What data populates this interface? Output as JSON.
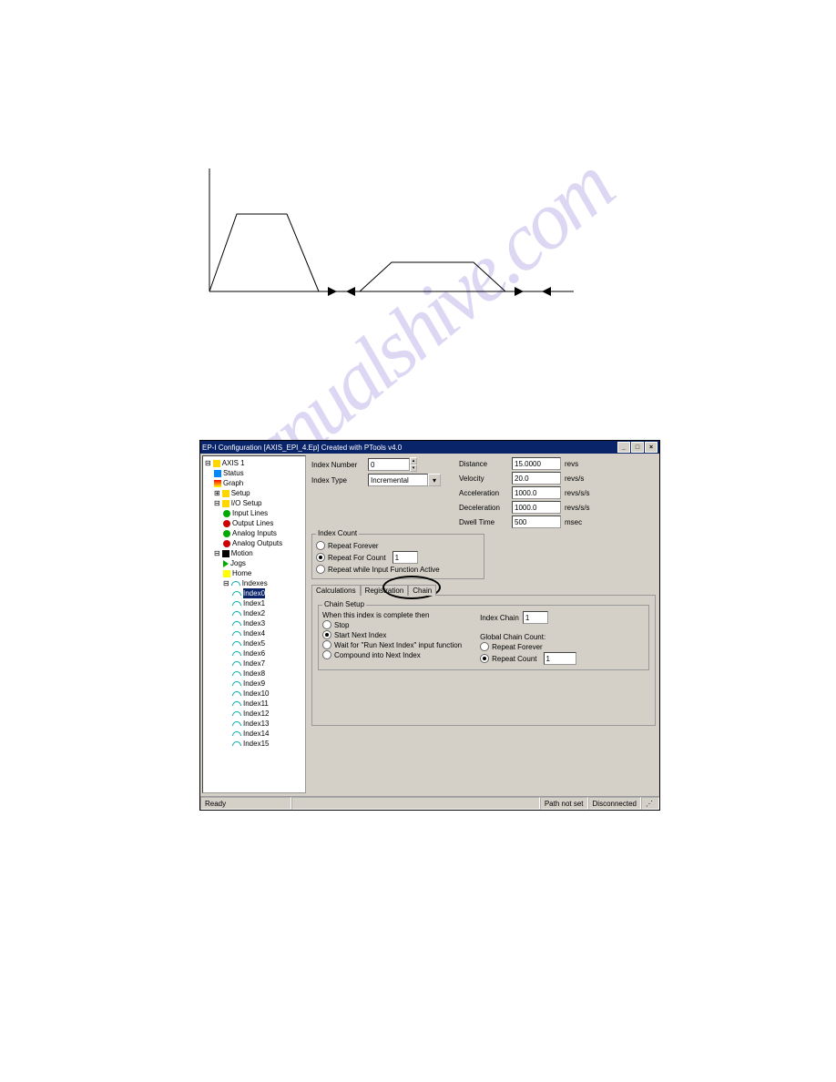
{
  "watermark": "manualshive.com",
  "chart_data": {
    "type": "line",
    "description": "Two trapezoidal velocity profiles with dwell arrows between them"
  },
  "window": {
    "title": "EP-I Configuration  [AXIS_EPI_4.Ep] Created with PTools v4.0",
    "min": "_",
    "max": "□",
    "close": "×"
  },
  "tree": {
    "root": "AXIS 1",
    "status": "Status",
    "graph": "Graph",
    "setup": "Setup",
    "iosetup": "I/O Setup",
    "inputlines": "Input Lines",
    "outputlines": "Output Lines",
    "analoginputs": "Analog Inputs",
    "analogoutputs": "Analog Outputs",
    "motion": "Motion",
    "jogs": "Jogs",
    "home": "Home",
    "indexes": "Indexes",
    "idx": [
      "Index0",
      "Index1",
      "Index2",
      "Index3",
      "Index4",
      "Index5",
      "Index6",
      "Index7",
      "Index8",
      "Index9",
      "Index10",
      "Index11",
      "Index12",
      "Index13",
      "Index14",
      "Index15"
    ]
  },
  "form": {
    "indexnum_l": "Index Number",
    "indexnum_v": "0",
    "indextype_l": "Index Type",
    "indextype_v": "Incremental",
    "distance_l": "Distance",
    "distance_v": "15.0000",
    "distance_u": "revs",
    "velocity_l": "Velocity",
    "velocity_v": "20.0",
    "velocity_u": "revs/s",
    "accel_l": "Acceleration",
    "accel_v": "1000.0",
    "accel_u": "revs/s/s",
    "decel_l": "Deceleration",
    "decel_v": "1000.0",
    "decel_u": "revs/s/s",
    "dwell_l": "Dwell Time",
    "dwell_v": "500",
    "dwell_u": "msec"
  },
  "indexcount": {
    "title": "Index Count",
    "r1": "Repeat Forever",
    "r2": "Repeat For Count",
    "r2v": "1",
    "r3": "Repeat while Input Function Active"
  },
  "tabs": {
    "t1": "Calculations",
    "t2": "Registration",
    "t3": "Chain"
  },
  "chain": {
    "title": "Chain Setup",
    "when": "When this index is complete then",
    "stop": "Stop",
    "start": "Start Next Index",
    "wait": "Wait for \"Run Next Index\" input function",
    "compound": "Compound into Next Index",
    "indexchain_l": "Index Chain",
    "indexchain_v": "1",
    "gcc": "Global Chain Count:",
    "rf": "Repeat Forever",
    "rc": "Repeat Count",
    "rc_v": "1"
  },
  "status": {
    "ready": "Ready",
    "path": "Path not set",
    "conn": "Disconnected"
  }
}
